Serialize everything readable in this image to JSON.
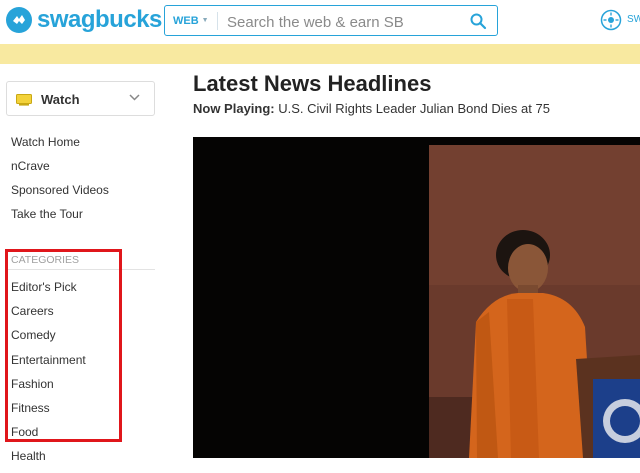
{
  "header": {
    "logo_text": "swagbucks",
    "search": {
      "scope_label": "WEB",
      "placeholder": "Search the web & earn SB"
    },
    "sb_label": "SW"
  },
  "sidebar": {
    "watch_dropdown": {
      "label": "Watch"
    },
    "nav": [
      {
        "label": "Watch Home"
      },
      {
        "label": "nCrave"
      },
      {
        "label": "Sponsored Videos"
      },
      {
        "label": "Take the Tour"
      }
    ],
    "categories_heading": "CATEGORIES",
    "categories": [
      {
        "label": "Editor's Pick"
      },
      {
        "label": "Careers"
      },
      {
        "label": "Comedy"
      },
      {
        "label": "Entertainment"
      },
      {
        "label": "Fashion"
      },
      {
        "label": "Fitness"
      },
      {
        "label": "Food"
      },
      {
        "label": "Health"
      }
    ]
  },
  "main": {
    "title": "Latest News Headlines",
    "now_playing_label": "Now Playing:",
    "now_playing_title": "U.S. Civil Rights Leader Julian Bond Dies at 75"
  },
  "colors": {
    "brand": "#27a3d9",
    "promo_bar": "#f8e9a0",
    "highlight": "#e0161b"
  }
}
